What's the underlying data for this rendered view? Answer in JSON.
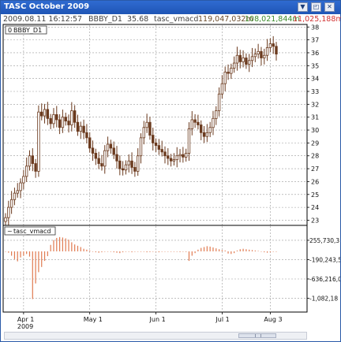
{
  "window": {
    "title": "TASC October 2009",
    "buttons": {
      "menu": "▼",
      "restore": "◰",
      "close": "✕"
    }
  },
  "infobar": {
    "timestamp": "2009.08.11 16:12:57",
    "symbol": "BBBY_D1",
    "price": "35.68",
    "indicator": "tasc_vmacd",
    "val1": "119,047,032m",
    "val2": "108,021,844m",
    "val3": "11,025,188m",
    "colors": {
      "text": "#444444",
      "val1": "#6a4a2a",
      "val2": "#3a8a2a",
      "val3": "#d03030"
    }
  },
  "main_panel": {
    "label": "BBBY_D1",
    "y_ticks": [
      "38",
      "37",
      "36",
      "35",
      "34",
      "33",
      "32",
      "31",
      "30",
      "29",
      "28",
      "27",
      "26",
      "25",
      "24",
      "23"
    ]
  },
  "sub_panel": {
    "label": "tasc_vmacd",
    "y_ticks": [
      "255,730,3",
      "-190,243,5",
      "-636,216,0",
      "-1,082,18"
    ]
  },
  "x_axis": {
    "ticks": [
      {
        "label": "Apr 1",
        "sub": "2009"
      },
      {
        "label": "May 1",
        "sub": ""
      },
      {
        "label": "Jun 1",
        "sub": ""
      },
      {
        "label": "Jul 1",
        "sub": ""
      },
      {
        "label": "Aug 3",
        "sub": ""
      }
    ]
  },
  "chart_data": [
    {
      "type": "bar",
      "subtype": "ohlc",
      "title": "BBBY_D1",
      "ylim": [
        22.6,
        38.2
      ],
      "grid": true,
      "color": "#6b3a1e",
      "close": [
        23.2,
        24.0,
        24.6,
        25.1,
        25.3,
        25.9,
        26.4,
        27.2,
        28.0,
        27.4,
        26.8,
        31.4,
        31.1,
        31.6,
        30.9,
        30.5,
        31.2,
        30.8,
        30.2,
        31.0,
        30.7,
        30.4,
        31.5,
        30.6,
        29.9,
        30.3,
        29.8,
        29.4,
        28.6,
        28.2,
        27.8,
        27.4,
        27.2,
        28.4,
        28.9,
        28.6,
        28.1,
        27.6,
        27.0,
        26.9,
        27.3,
        27.6,
        27.1,
        26.8,
        28.0,
        29.4,
        30.2,
        30.6,
        29.6,
        29.0,
        28.8,
        28.5,
        28.3,
        28.0,
        27.8,
        27.6,
        27.7,
        28.0,
        28.1,
        27.9,
        28.2,
        30.1,
        30.8,
        30.6,
        30.4,
        29.8,
        29.5,
        29.8,
        30.2,
        30.9,
        31.5,
        32.8,
        33.6,
        34.5,
        34.4,
        34.8,
        35.2,
        35.8,
        35.3,
        35.6,
        35.1,
        35.4,
        35.7,
        35.9,
        36.1,
        35.6,
        35.8,
        36.4,
        36.7,
        36.5,
        35.9
      ]
    },
    {
      "type": "bar",
      "title": "tasc_vmacd",
      "ylim": [
        -1400000000,
        600000000
      ],
      "grid": true,
      "color": "#e07a50",
      "values": [
        0,
        -30000000.0,
        -100000000.0,
        -180000000.0,
        -230000000.0,
        -140000000.0,
        -100000000.0,
        -60000000.0,
        -120000000.0,
        -1100000000.0,
        -740000000.0,
        -480000000.0,
        -360000000.0,
        -220000000.0,
        -110000000.0,
        150000000.0,
        260000000.0,
        310000000.0,
        330000000.0,
        320000000.0,
        300000000.0,
        270000000.0,
        210000000.0,
        160000000.0,
        130000000.0,
        100000000.0,
        60000000.0,
        40000000.0,
        20000000.0,
        -10000000.0,
        -20000000.0,
        -30000000.0,
        -20000000.0,
        -10000000.0,
        0,
        -10000000.0,
        -20000000.0,
        -30000000.0,
        -40000000.0,
        -20000000.0,
        -10000000.0,
        -10000000.0,
        -20000000.0,
        -10000000.0,
        0,
        -10000000.0,
        -10000000.0,
        -20000000.0,
        -15000000.0,
        -10000000.0,
        -10000000.0,
        -20000000.0,
        -10000000.0,
        0,
        0,
        -10000000.0,
        -10000000.0,
        -10000000.0,
        -15000000.0,
        -10000000.0,
        -13000000.0,
        -220000000.0,
        -100000000.0,
        -40000000.0,
        40000000.0,
        80000000.0,
        100000000.0,
        120000000.0,
        110000000.0,
        90000000.0,
        70000000.0,
        50000000.0,
        30000000.0,
        20000000.0,
        -50000000.0,
        -60000000.0,
        -40000000.0,
        20000000.0,
        50000000.0,
        60000000.0,
        50000000.0,
        40000000.0,
        30000000.0,
        20000000.0,
        10000000.0,
        0,
        -20000000.0,
        -30000000.0,
        -20000000.0,
        -10000000.0,
        -10000000.0
      ]
    }
  ]
}
